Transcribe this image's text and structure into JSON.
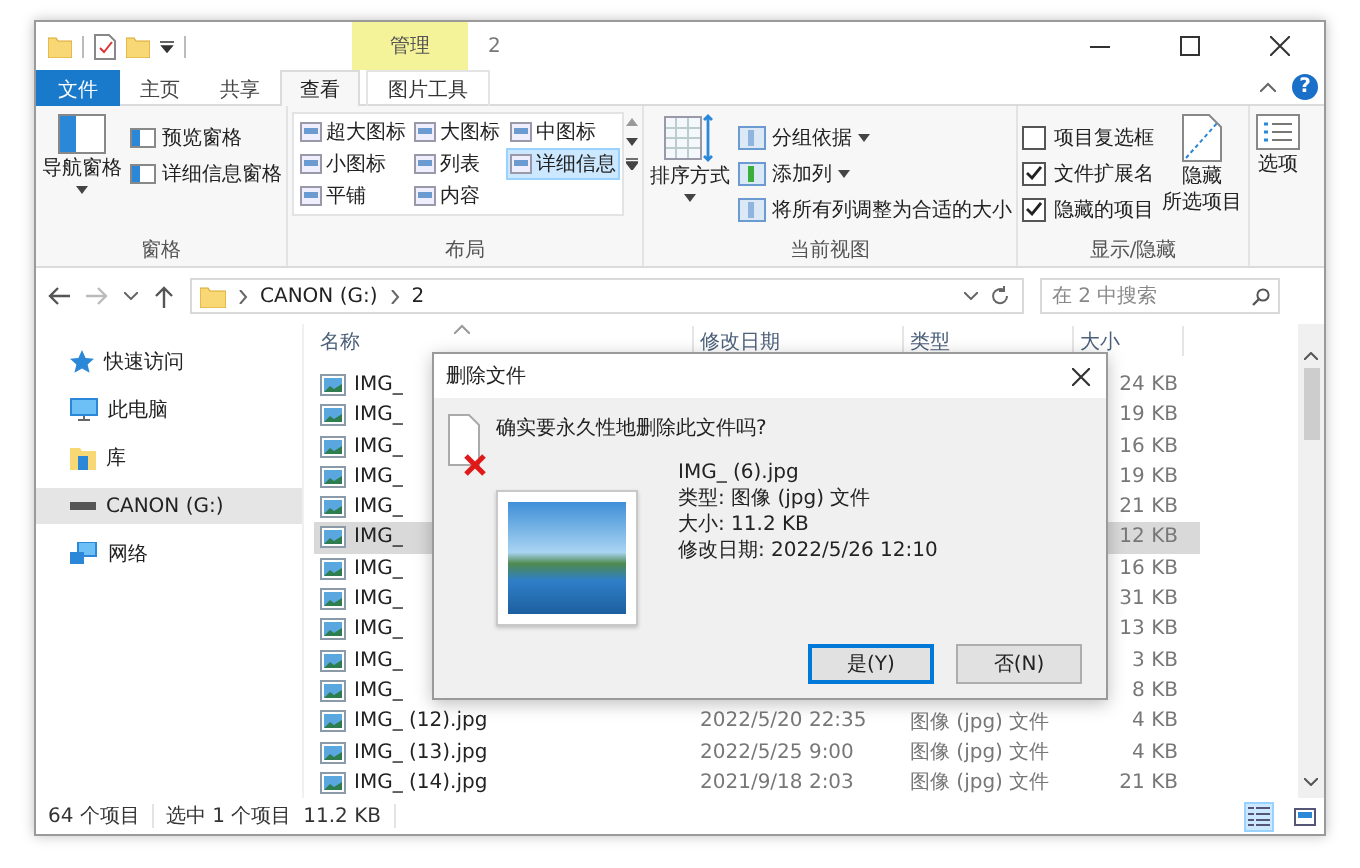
{
  "title_bar": {
    "context_label": "管理",
    "title": "2"
  },
  "ribbon_tabs": [
    {
      "label": "文件",
      "kind": "file",
      "selected": false
    },
    {
      "label": "主页",
      "kind": "tab",
      "selected": false
    },
    {
      "label": "共享",
      "kind": "tab",
      "selected": false
    },
    {
      "label": "查看",
      "kind": "tab",
      "selected": true
    },
    {
      "label": "图片工具",
      "kind": "context",
      "selected": false
    }
  ],
  "help": "?",
  "panes_group": {
    "label": "窗格",
    "large": "导航窗格",
    "items": [
      "预览窗格",
      "详细信息窗格"
    ]
  },
  "layout_group": {
    "label": "布局",
    "options": [
      {
        "label": "超大图标",
        "selected": false
      },
      {
        "label": "大图标",
        "selected": false
      },
      {
        "label": "中图标",
        "selected": false
      },
      {
        "label": "小图标",
        "selected": false
      },
      {
        "label": "列表",
        "selected": false
      },
      {
        "label": "详细信息",
        "selected": true
      },
      {
        "label": "平铺",
        "selected": false
      },
      {
        "label": "内容",
        "selected": false
      }
    ]
  },
  "current_view_group": {
    "label": "当前视图",
    "large": "排序方式",
    "items": [
      {
        "label": "分组依据",
        "dropdown": true
      },
      {
        "label": "添加列",
        "dropdown": true
      },
      {
        "label": "将所有列调整为合适的大小",
        "dropdown": false
      }
    ]
  },
  "show_hide_group": {
    "label": "显示/隐藏",
    "checkboxes": [
      {
        "label": "项目复选框",
        "checked": false
      },
      {
        "label": "文件扩展名",
        "checked": true
      },
      {
        "label": "隐藏的项目",
        "checked": true
      }
    ],
    "large": [
      "隐藏",
      "所选项目"
    ]
  },
  "options_group": {
    "label": "选项"
  },
  "address_bar": {
    "path": [
      "CANON (G:)",
      "2"
    ],
    "search_placeholder": "在 2 中搜索"
  },
  "sidebar": {
    "items": [
      {
        "label": "快速访问",
        "kind": "star",
        "selected": false
      },
      {
        "label": "此电脑",
        "kind": "pc",
        "selected": false
      },
      {
        "label": "库",
        "kind": "library",
        "selected": false
      },
      {
        "label": "CANON (G:)",
        "kind": "drive",
        "selected": true
      },
      {
        "label": "网络",
        "kind": "network",
        "selected": false
      }
    ]
  },
  "table": {
    "columns": [
      "名称",
      "修改日期",
      "类型",
      "大小"
    ],
    "rows": [
      {
        "name": "IMG_",
        "size": "24 KB",
        "selected": false
      },
      {
        "name": "IMG_",
        "size": "19 KB",
        "selected": false
      },
      {
        "name": "IMG_",
        "size": "16 KB",
        "selected": false
      },
      {
        "name": "IMG_",
        "size": "19 KB",
        "selected": false
      },
      {
        "name": "IMG_",
        "size": "21 KB",
        "selected": false
      },
      {
        "name": "IMG_",
        "size": "12 KB",
        "selected": true
      },
      {
        "name": "IMG_",
        "size": "16 KB",
        "selected": false
      },
      {
        "name": "IMG_",
        "size": "31 KB",
        "selected": false
      },
      {
        "name": "IMG_",
        "size": "13 KB",
        "selected": false
      },
      {
        "name": "IMG_",
        "size": "3 KB",
        "selected": false
      },
      {
        "name": "IMG_",
        "size": "8 KB",
        "selected": false
      },
      {
        "name": "IMG_ (12).jpg",
        "date": "2022/5/20 22:35",
        "type": "图像 (jpg) 文件",
        "size": "4 KB",
        "selected": false
      },
      {
        "name": "IMG_ (13).jpg",
        "date": "2022/5/25 9:00",
        "type": "图像 (jpg) 文件",
        "size": "4 KB",
        "selected": false
      },
      {
        "name": "IMG_ (14).jpg",
        "date": "2021/9/18 2:03",
        "type": "图像 (jpg) 文件",
        "size": "21 KB",
        "selected": false
      }
    ]
  },
  "dialog": {
    "title": "删除文件",
    "question": "确实要永久性地删除此文件吗?",
    "file_name": "IMG_ (6).jpg",
    "details": [
      "类型: 图像 (jpg) 文件",
      "大小: 11.2 KB",
      "修改日期: 2022/5/26 12:10"
    ],
    "buttons": [
      {
        "label": "是(Y)",
        "focused": true
      },
      {
        "label": "否(N)",
        "focused": false
      }
    ]
  },
  "status_bar": {
    "item_count": "64 个项目",
    "selection": "选中 1 个项目",
    "selection_size": "11.2 KB",
    "view_buttons": [
      {
        "kind": "details",
        "selected": true
      },
      {
        "kind": "thumbnails",
        "selected": false
      }
    ]
  }
}
